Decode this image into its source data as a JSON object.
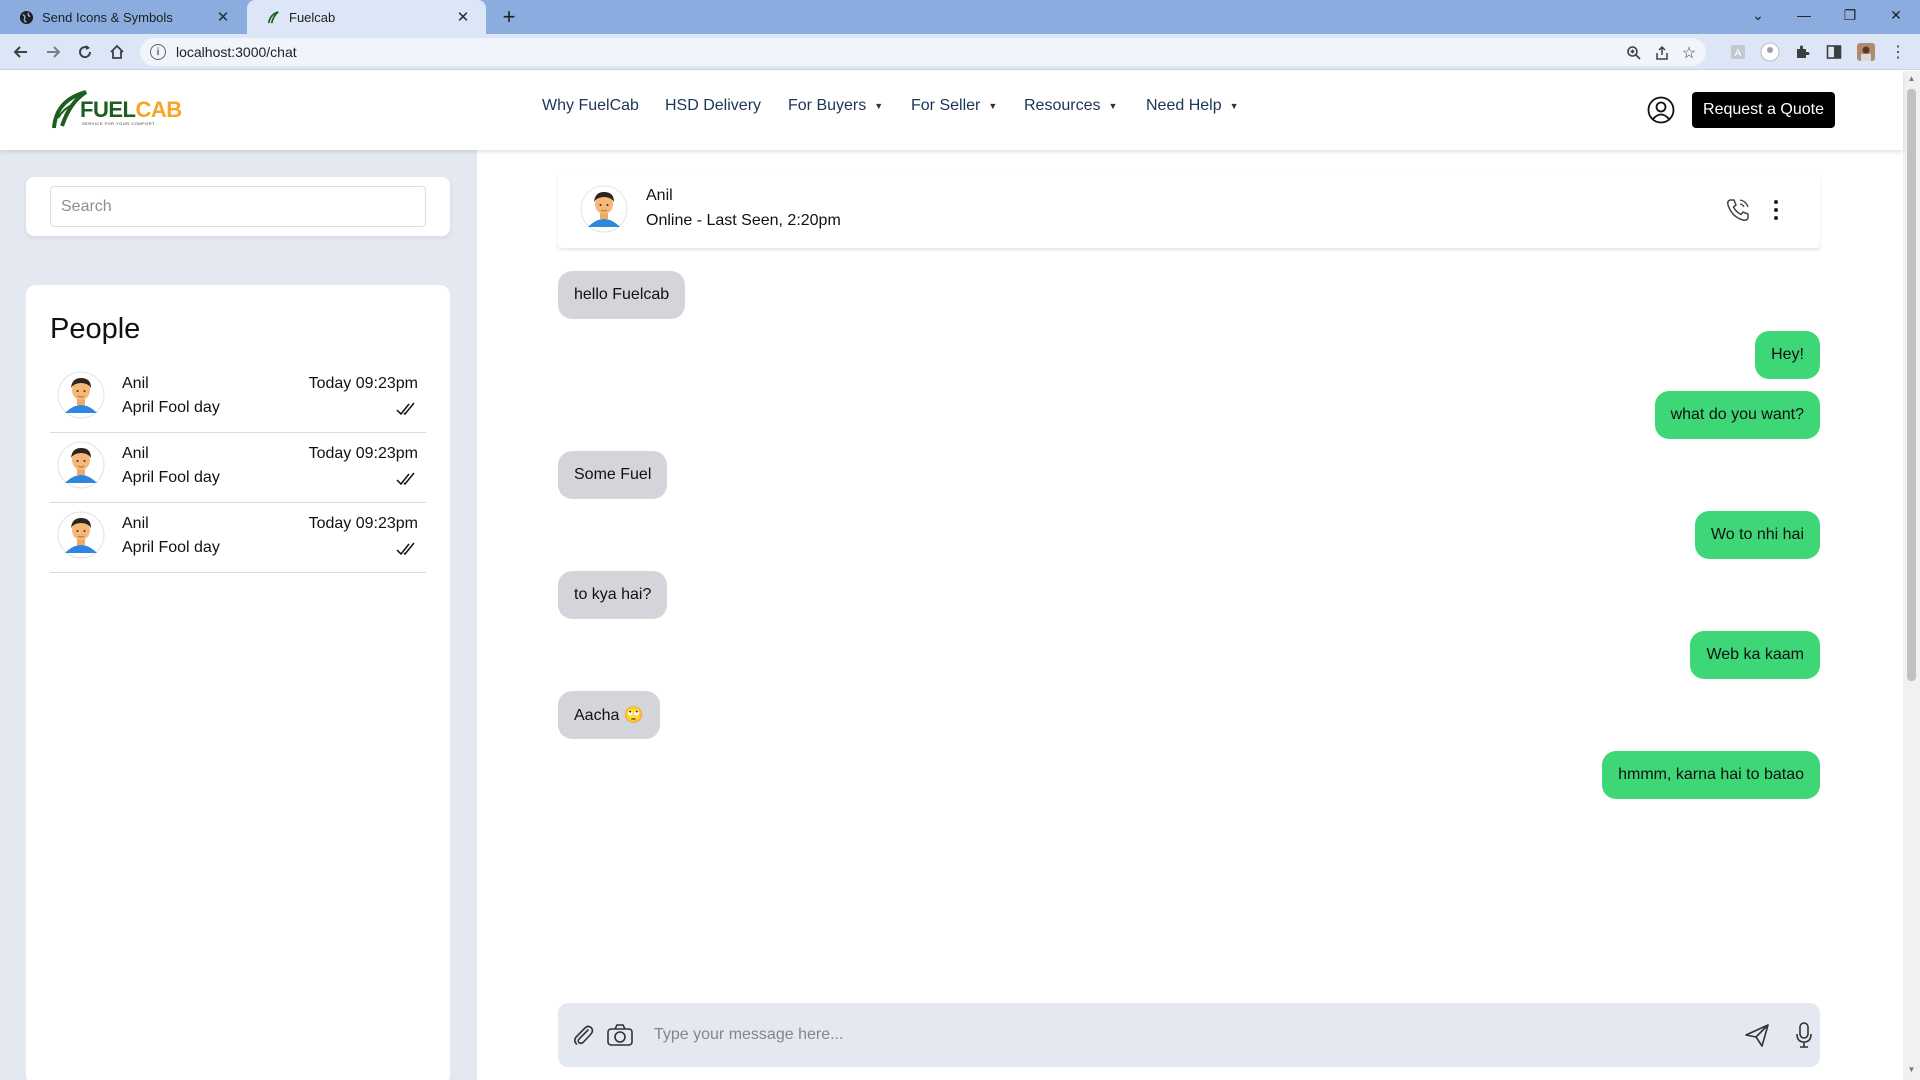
{
  "browser": {
    "tabs": [
      {
        "title": "Send Icons & Symbols",
        "active": false
      },
      {
        "title": "Fuelcab",
        "active": true
      }
    ],
    "url": "localhost:3000/chat"
  },
  "site": {
    "logo": {
      "part1": "FUEL",
      "part2": "CAB",
      "tagline": "SERVICE FOR YOUR COMFORT"
    },
    "nav": [
      {
        "label": "Why FuelCab",
        "dropdown": false
      },
      {
        "label": "HSD Delivery",
        "dropdown": false
      },
      {
        "label": "For Buyers",
        "dropdown": true
      },
      {
        "label": "For Seller",
        "dropdown": true
      },
      {
        "label": "Resources",
        "dropdown": true
      },
      {
        "label": "Need Help",
        "dropdown": true
      }
    ],
    "quote_button": "Request a Quote",
    "colors": {
      "accent_green": "#3ed778",
      "incoming_bubble": "#d3d5da",
      "nav_text": "#1d3557",
      "panel_bg": "#e4e9f1",
      "logo_green": "#1b5e20",
      "logo_orange": "#f5a623"
    }
  },
  "sidebar": {
    "search_placeholder": "Search",
    "people_title": "People",
    "people": [
      {
        "name": "Anil",
        "last_message": "April Fool day",
        "time": "Today 09:23pm"
      },
      {
        "name": "Anil",
        "last_message": "April Fool day",
        "time": "Today 09:23pm"
      },
      {
        "name": "Anil",
        "last_message": "April Fool day",
        "time": "Today 09:23pm"
      }
    ]
  },
  "chat": {
    "contact_name": "Anil",
    "contact_status": "Online - Last Seen, 2:20pm",
    "messages": [
      {
        "direction": "in",
        "text": "hello Fuelcab"
      },
      {
        "direction": "out",
        "text": "Hey!"
      },
      {
        "direction": "out",
        "text": "what do you want?"
      },
      {
        "direction": "in",
        "text": "Some Fuel"
      },
      {
        "direction": "out",
        "text": "Wo to nhi hai"
      },
      {
        "direction": "in",
        "text": "to kya hai?"
      },
      {
        "direction": "out",
        "text": "Web ka kaam"
      },
      {
        "direction": "in",
        "text": "Aacha 🙄"
      },
      {
        "direction": "out",
        "text": "hmmm, karna hai to batao"
      }
    ],
    "composer_placeholder": "Type your message here..."
  }
}
